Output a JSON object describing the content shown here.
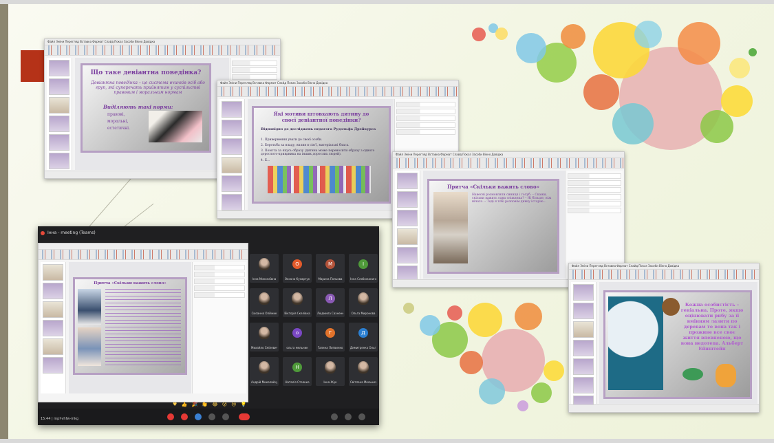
{
  "windows": {
    "top_left": {
      "menu": "Файл  Зміни  Перегляд  Вставка  Формат  Слайд  Показ  Засоби  Вікно  Довідка",
      "slide_title": "Що таке девіантна поведінка?",
      "definition": "Девіантна поведінка – це система вчинків осіб або груп, які суперечать прийнятим у суспільстві правовим і моральним нормам",
      "norms_heading": "Виділяють такі норми:",
      "norms": [
        "правові,",
        "моральні,",
        "естетичні."
      ]
    },
    "top_middle": {
      "menu": "Файл  Зміни  Перегляд  Вставка  Формат  Слайд  Показ  Засоби  Вікно  Довідка",
      "slide_title": "Які мотиви штовхають дитину до своєї девіантної поведінки?",
      "subtitle": "Відповідно до досліджень педагога Рудольфа Дрейкурса",
      "points": [
        "1. Привернення уваги до своєї особи.",
        "2. Боротьба за владу, вплив в сім'ї, матеріальні блага.",
        "3. Помста за якусь образу (дитина може переносити образу з одного дорослого-кривдника на інших дорослих людей).",
        "4. Б..."
      ]
    },
    "right_middle": {
      "menu": "Файл  Зміни  Перегляд  Вставка  Формат  Слайд  Показ  Засоби  Вікно  Довідка",
      "slide_title": "Притча «Скільки важить слово»",
      "text": "Навесні розмовляли синиця і голуб. – Скажи, скільки важить одна сніжинка? – Ні більше, ніж нічого. – Тоді я тобі розповім дивну історію..."
    },
    "bottom_right": {
      "menu": "Файл  Зміни  Перегляд  Вставка  Формат  Слайд  Показ  Засоби  Вікно  Довідка",
      "quote": "Кожна особистість – геніальна. Проте, якщо оцінювати рибу за її вмінням лазити по деревам то вона так і проживе все своє життя впевненою, що вона недотепа. Альберт Ейнштейн"
    }
  },
  "call": {
    "title": "Інна - meeting (Teams)",
    "shared_slide_title": "Притча «Скільки важить слово»",
    "footer": "15:44  |  mpf-vhfw-mkg",
    "tiles": [
      {
        "name": "Інна Миколаївна",
        "initial": "",
        "color": "#7b8fb0",
        "photo": true
      },
      {
        "name": "Оксана Кухарчук",
        "initial": "О",
        "color": "#e25a2b"
      },
      {
        "name": "Марина Польова",
        "initial": "М",
        "color": "#b3533a"
      },
      {
        "name": "Інна Слобожанина",
        "initial": "І",
        "color": "#4f9a3a"
      },
      {
        "name": "Сюзанна Олійник",
        "initial": "",
        "color": "#7b8fb0",
        "photo": true
      },
      {
        "name": "Вікторія Скелівна",
        "initial": "",
        "color": "#7b8fb0",
        "photo": true
      },
      {
        "name": "Людмила Сахненко",
        "initial": "Л",
        "color": "#8a5ab5"
      },
      {
        "name": "Ольга Миронова",
        "initial": "",
        "color": "#7b8fb0",
        "photo": true
      },
      {
        "name": "Михайло Смілевич",
        "initial": "",
        "color": "#7b8fb0",
        "photo": true
      },
      {
        "name": "ольга мельник",
        "initial": "о",
        "color": "#7a48c4"
      },
      {
        "name": "Галина Литвинко",
        "initial": "Г",
        "color": "#e2732b"
      },
      {
        "name": "Димитренко Ольга",
        "initial": "Д",
        "color": "#2b7fd1"
      },
      {
        "name": "Андрій Миколайчук",
        "initial": "",
        "color": "#7b8fb0",
        "photo": true
      },
      {
        "name": "Наталія Стоянко",
        "initial": "Н",
        "color": "#4f9a3a"
      },
      {
        "name": "Інна Жук",
        "initial": "",
        "color": "#7b8fb0",
        "photo": true
      },
      {
        "name": "Світлана Мельниченко",
        "initial": "",
        "color": "#7b8fb0",
        "photo": true
      }
    ],
    "reactions": "♥ 👍 🎉 👏 😂 😮 😢 💡"
  },
  "icons": [
    "mic-icon",
    "camera-icon",
    "share-screen-icon",
    "reactions-icon",
    "end-call-icon",
    "participants-icon",
    "chat-icon"
  ],
  "colors": {
    "accent_red": "#b53218",
    "slide_purple": "#7b3f9f",
    "call_bg": "#1f1f21"
  }
}
